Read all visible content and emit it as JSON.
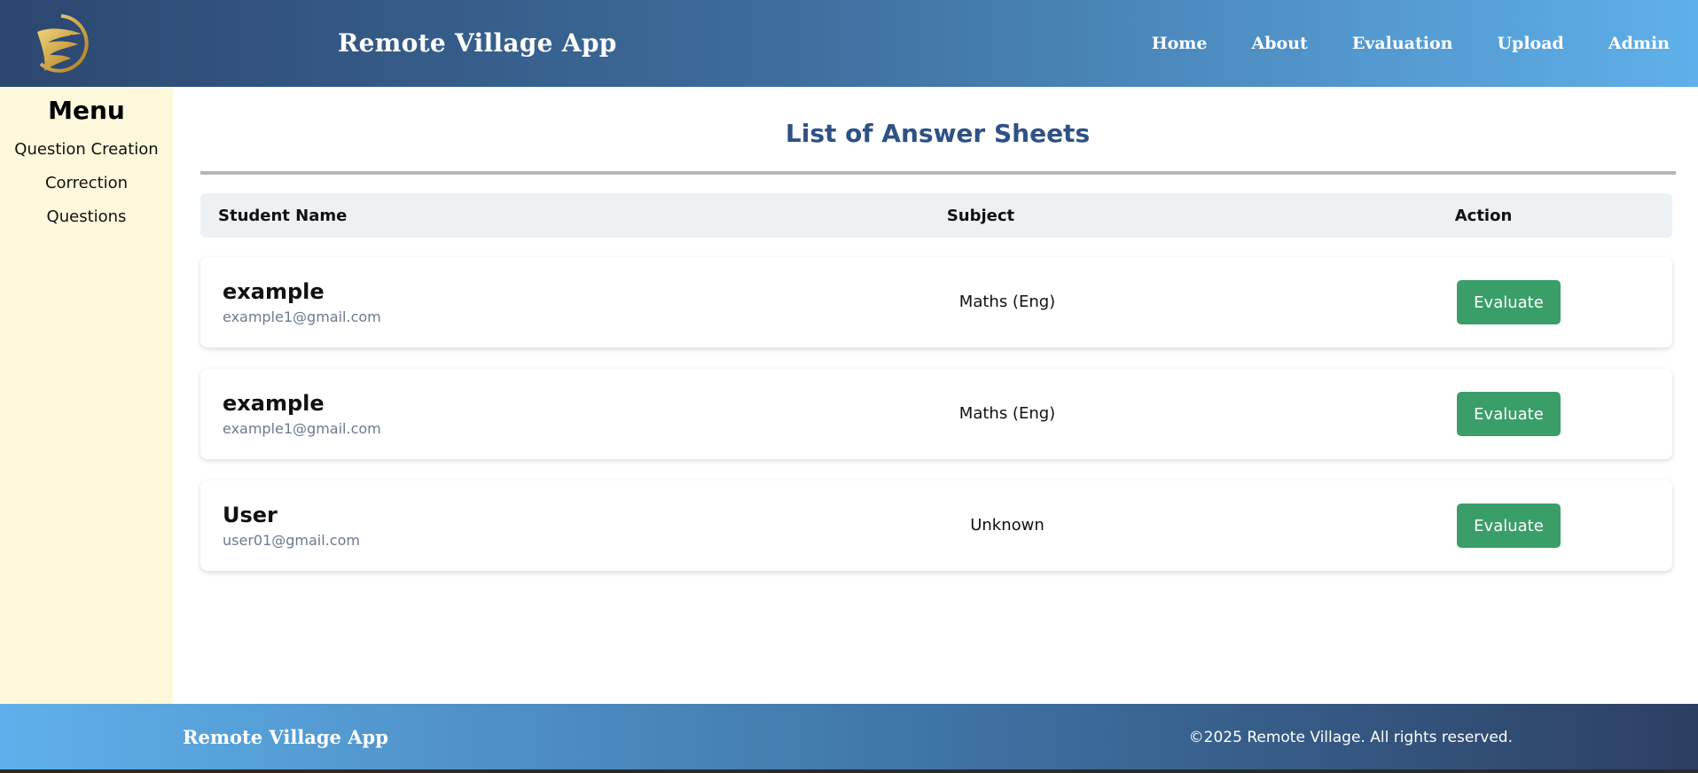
{
  "header": {
    "title": "Remote Village App",
    "logo_icon": "eagle-logo-icon",
    "nav": [
      "Home",
      "About",
      "Evaluation",
      "Upload",
      "Admin"
    ]
  },
  "sidebar": {
    "title": "Menu",
    "items": [
      "Question Creation",
      "Correction",
      "Questions"
    ]
  },
  "main": {
    "title": "List of Answer Sheets",
    "columns": {
      "name": "Student Name",
      "subject": "Subject",
      "action": "Action"
    },
    "rows": [
      {
        "name": "example",
        "email": "example1@gmail.com",
        "subject": "Maths (Eng)",
        "action": "Evaluate"
      },
      {
        "name": "example",
        "email": "example1@gmail.com",
        "subject": "Maths (Eng)",
        "action": "Evaluate"
      },
      {
        "name": "User",
        "email": "user01@gmail.com",
        "subject": "Unknown",
        "action": "Evaluate"
      }
    ]
  },
  "footer": {
    "title": "Remote Village App",
    "copyright": "©2025 Remote Village. All rights reserved."
  },
  "colors": {
    "header_start": "#2c4770",
    "header_end": "#5fb0ea",
    "sidebar_bg": "#fdf8dc",
    "title_color": "#2e5186",
    "button_green": "#3a9e68"
  }
}
